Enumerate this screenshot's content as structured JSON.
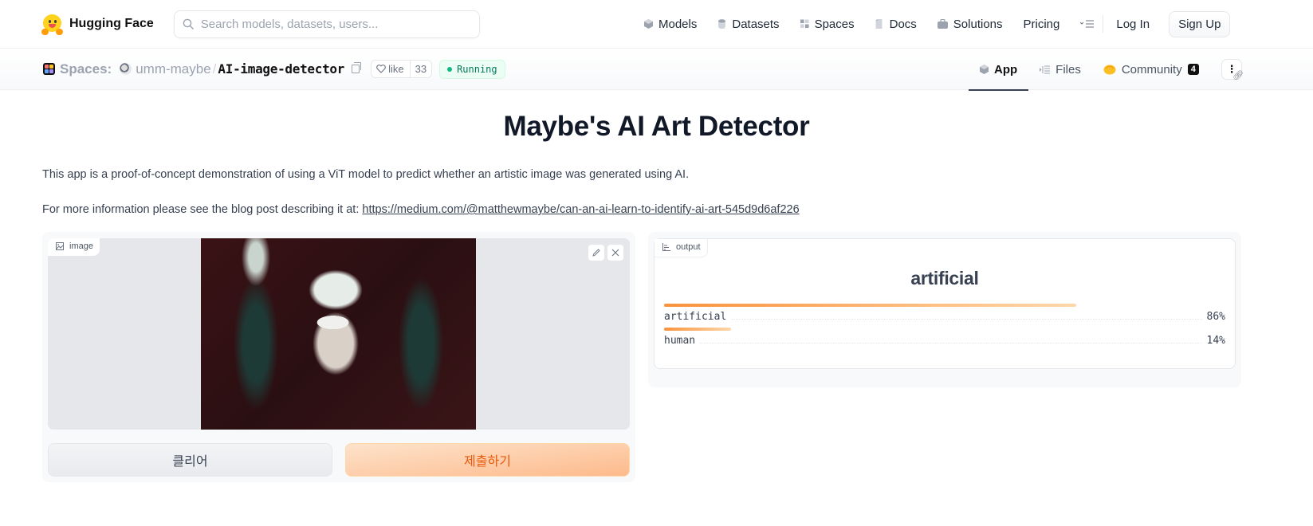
{
  "nav": {
    "brand": "Hugging Face",
    "search_placeholder": "Search models, datasets, users...",
    "links": [
      {
        "label": "Models",
        "icon": "cube-icon"
      },
      {
        "label": "Datasets",
        "icon": "database-icon"
      },
      {
        "label": "Spaces",
        "icon": "grid-icon"
      },
      {
        "label": "Docs",
        "icon": "doc-icon"
      },
      {
        "label": "Solutions",
        "icon": "briefcase-icon"
      },
      {
        "label": "Pricing",
        "icon": ""
      }
    ],
    "more_icon": "menu-icon",
    "login": "Log In",
    "signup": "Sign Up"
  },
  "space": {
    "section_label": "Spaces:",
    "owner": "umm-maybe",
    "separator": "/",
    "repo": "AI-image-detector",
    "like_label": "like",
    "like_count": "33",
    "status": "Running",
    "tabs": [
      {
        "label": "App",
        "active": true
      },
      {
        "label": "Files",
        "active": false
      },
      {
        "label": "Community",
        "active": false,
        "badge": "4"
      }
    ],
    "more_label": "⋮"
  },
  "app": {
    "title": "Maybe's AI Art Detector",
    "description": "This app is a proof-of-concept demonstration of using a ViT model to predict whether an artistic image was generated using AI.",
    "more_info_prefix": "For more information please see the blog post describing it at: ",
    "more_info_link": "https://medium.com/@matthewmaybe/can-an-ai-learn-to-identify-ai-art-545d9d6af226",
    "input_label": "image",
    "clear_button": "클리어",
    "submit_button": "제출하기",
    "output_label": "output",
    "output_title": "artificial",
    "confidences": [
      {
        "label": "artificial",
        "percent_text": "86%",
        "value": 0.86
      },
      {
        "label": "human",
        "percent_text": "14%",
        "value": 0.14
      }
    ]
  }
}
